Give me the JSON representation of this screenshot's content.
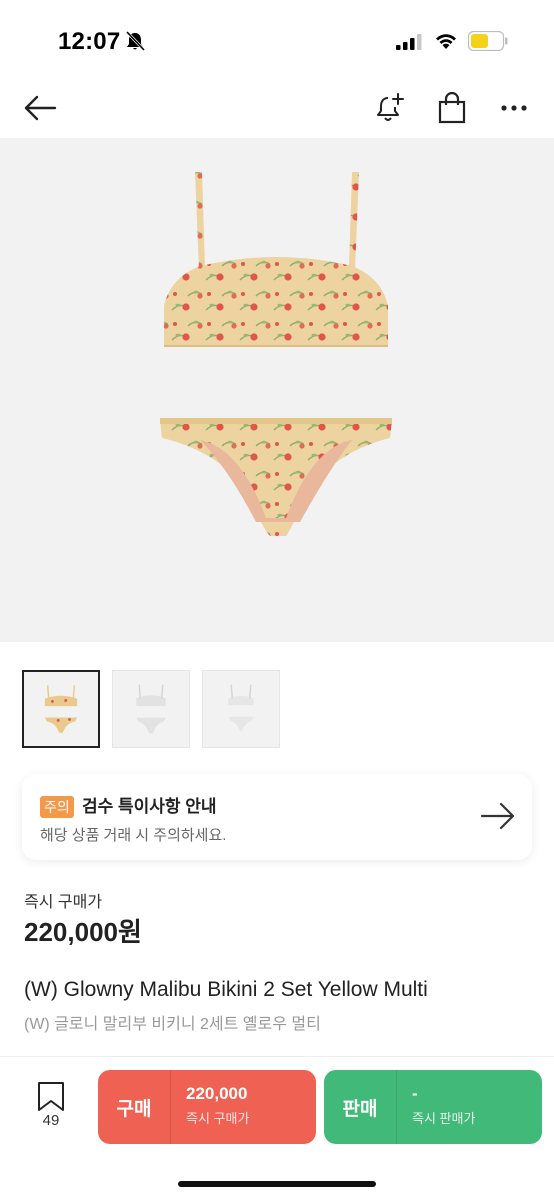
{
  "status_bar": {
    "time": "12:07",
    "icons": [
      "bell-off-icon",
      "signal-icon",
      "wifi-icon",
      "battery-icon"
    ],
    "battery_color": "#f5d21a"
  },
  "top_nav": {
    "icons": [
      "back-arrow-icon",
      "bell-plus-icon",
      "shopping-bag-icon",
      "more-icon"
    ]
  },
  "product_images": {
    "thumbnails": [
      {
        "name": "thumb-yellow-floral",
        "active": true
      },
      {
        "name": "thumb-white",
        "active": false
      },
      {
        "name": "thumb-white-alt",
        "active": false
      }
    ]
  },
  "notice": {
    "badge": "주의",
    "title": "검수 특이사항 안내",
    "subtitle": "해당 상품 거래 시 주의하세요.",
    "badge_color": "#f2994a"
  },
  "price": {
    "label": "즉시 구매가",
    "value": "220,000원"
  },
  "product": {
    "name_en": "(W) Glowny Malibu Bikini 2 Set Yellow Multi",
    "name_ko": "(W) 글로니 말리부 비키니 2세트 옐로우 멀티"
  },
  "bottom_bar": {
    "bookmark_count": "49",
    "buy": {
      "label": "구매",
      "price": "220,000",
      "sub": "즉시 구매가",
      "color": "#ef6253"
    },
    "sell": {
      "label": "판매",
      "price": "-",
      "sub": "즉시 판매가",
      "color": "#41b979"
    }
  }
}
